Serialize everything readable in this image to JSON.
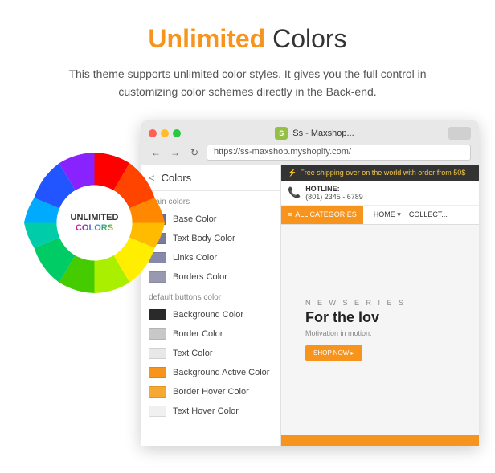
{
  "headline": {
    "part1": "Unlimited",
    "part2": "Colors"
  },
  "subtitle": "This theme supports unlimited color styles. It gives you the full control in customizing color schemes directly in the Back-end.",
  "wheel_center": {
    "line1": "Unlimited",
    "line2": "COLORS"
  },
  "browser": {
    "tab_title": "Ss - Maxshop...",
    "address": "https://ss-maxshop.myshopify.com/",
    "panel_title": "Colors",
    "back_label": "<",
    "section_main": "main colors",
    "section_default": "default buttons color",
    "main_colors": [
      {
        "label": "Base Color",
        "color": "#6b6b9b"
      },
      {
        "label": "Text Body Color",
        "color": "#7a7a9a"
      },
      {
        "label": "Links Color",
        "color": "#8888aa"
      },
      {
        "label": "Borders Color",
        "color": "#9898b0"
      }
    ],
    "default_colors": [
      {
        "label": "Background Color",
        "color": "#2a2a2a"
      },
      {
        "label": "Border Color",
        "color": "#c8c8c8"
      },
      {
        "label": "Text Color",
        "color": "#f0f0f0"
      },
      {
        "label": "Background Active Color",
        "color": "#f7941d"
      },
      {
        "label": "Border Hover Color",
        "color": "#f5a832"
      },
      {
        "label": "Text Hover Color",
        "color": "#ffffff"
      }
    ],
    "promo_text": "Free shipping over on the world with order from 50$",
    "hotline_label": "HOTLINE:",
    "hotline_number": "(801) 2345 - 6789",
    "nav_categories": "ALL CATEGORIES",
    "nav_home": "HOME ▾",
    "nav_collection": "COLLECT...",
    "hero_series": "N E W   S E R I E S",
    "hero_title": "For the lov",
    "hero_subtitle": "Motivation in motion.",
    "shop_btn": "SHOP NOW ▸"
  }
}
